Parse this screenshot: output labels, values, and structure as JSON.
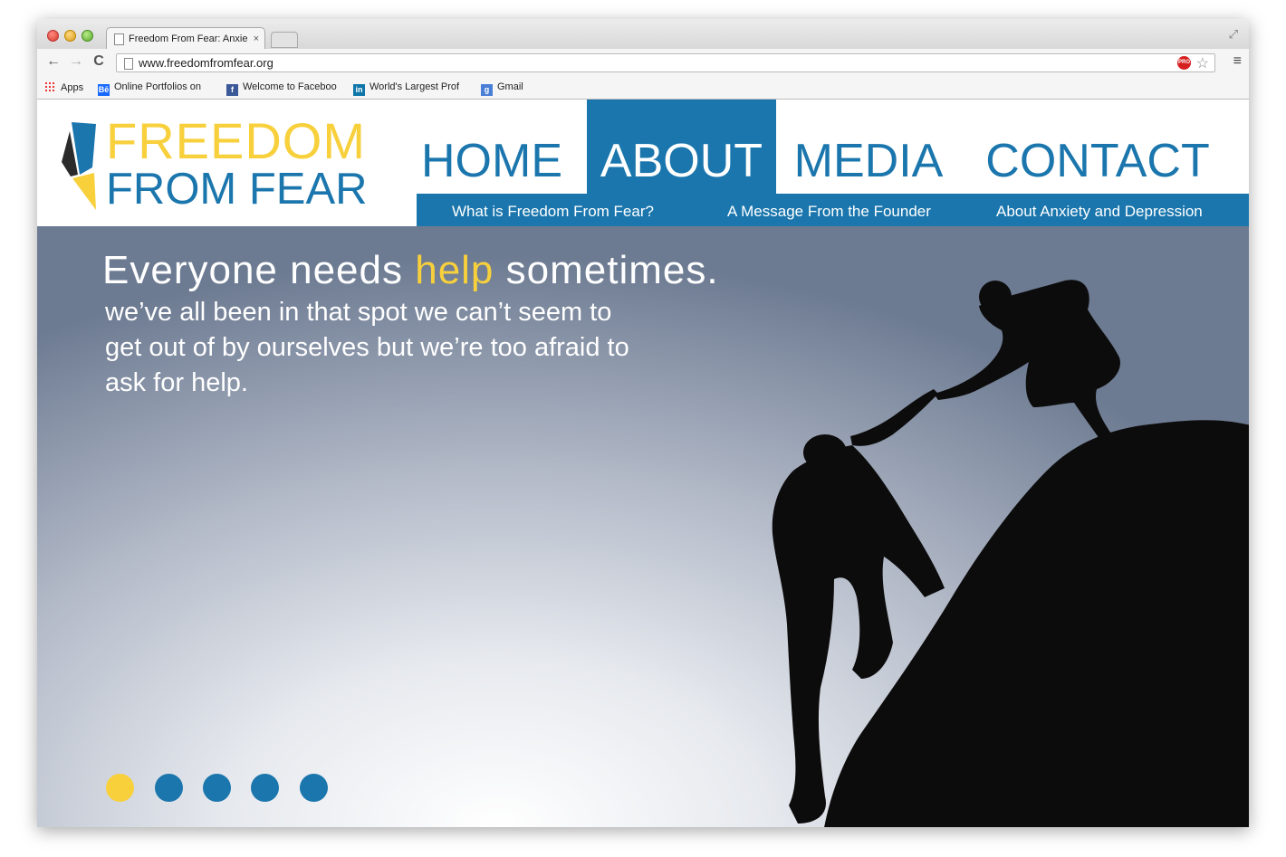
{
  "browser": {
    "tab_title": "Freedom From Fear: Anxie",
    "tab_close": "×",
    "url": "www.freedomfromfear.org",
    "back": "←",
    "forward": "→",
    "reload": "C",
    "pro_badge": "PRO",
    "star": "☆",
    "menu": "≡",
    "fullscreen": "⤢",
    "bookmarks": [
      {
        "label": "Apps"
      },
      {
        "label": "Online Portfolios on",
        "icon_text": "Bē"
      },
      {
        "label": "Welcome to Faceboo",
        "icon_text": "f"
      },
      {
        "label": "World's Largest Prof",
        "icon_text": "in"
      },
      {
        "label": "Gmail",
        "icon_text": "g"
      }
    ]
  },
  "site": {
    "logo": {
      "line1": "FREEDOM",
      "line2": "FROM FEAR"
    },
    "nav": [
      {
        "label": "HOME"
      },
      {
        "label": "ABOUT",
        "active": true
      },
      {
        "label": "MEDIA"
      },
      {
        "label": "CONTACT"
      }
    ],
    "subnav": [
      {
        "label": "What is Freedom From Fear?"
      },
      {
        "label": "A Message From the Founder"
      },
      {
        "label": "About Anxiety and Depression"
      }
    ],
    "hero": {
      "title_before": "Everyone needs ",
      "title_highlight": "help",
      "title_after": " sometimes.",
      "subtitle": "we’ve all been in that spot we can’t seem to get out of by ourselves but we’re too afraid to ask for help."
    },
    "slider": {
      "count": 5,
      "active_index": 0
    }
  },
  "colors": {
    "brand_blue": "#1a76ad",
    "brand_yellow": "#f7d03c"
  }
}
